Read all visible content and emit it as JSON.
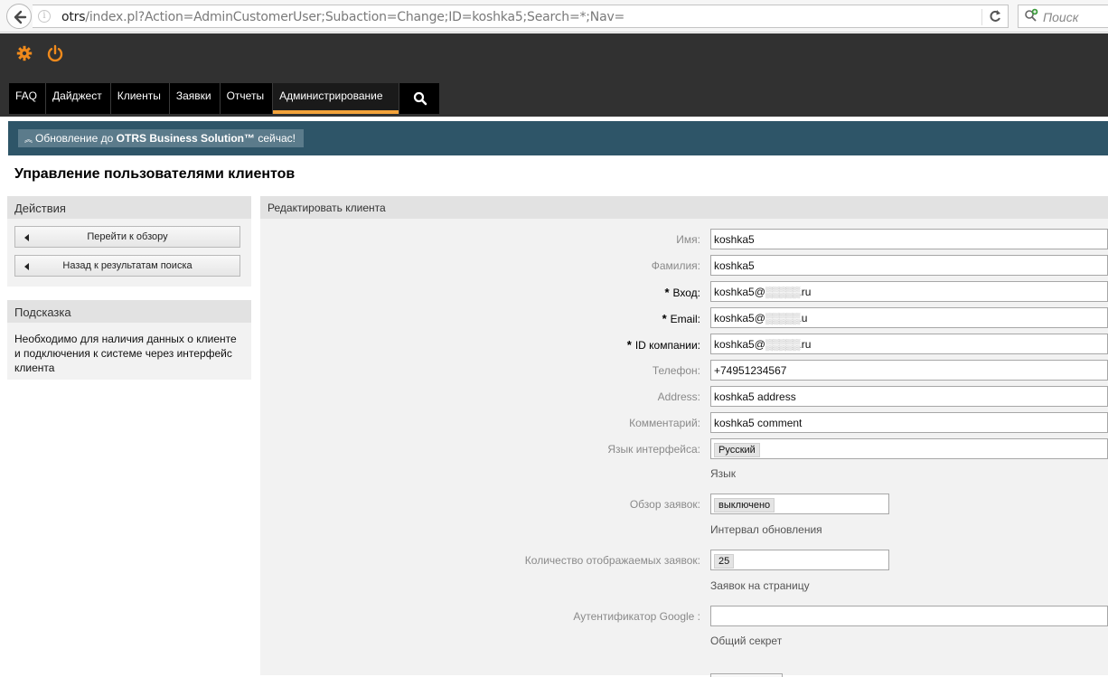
{
  "browser": {
    "url_host": "otrs",
    "url_rest": "/index.pl?Action=AdminCustomerUser;Subaction=Change;ID=koshka5;Search=*;Nav=",
    "search_placeholder": "Поиск"
  },
  "header": {
    "nav": [
      "FAQ",
      "Дайджест",
      "Клиенты",
      "Заявки",
      "Отчеты",
      "Администрирование"
    ],
    "active_nav": "Администрирование",
    "accent_color": "#f2a23a"
  },
  "upgrade": {
    "prefix": "Обновление до ",
    "product": "OTRS Business Solution™",
    "suffix": " сейчас!"
  },
  "page_title": "Управление пользователями клиентов",
  "sidebar": {
    "actions_title": "Действия",
    "go_overview": "Перейти к обзору",
    "back_to_results": "Назад к результатам поиска",
    "hint_title": "Подсказка",
    "hint_text": "Необходимо для наличия данных о клиенте и подключения к системе через интерфейс клиента"
  },
  "form": {
    "title": "Редактировать клиента",
    "fields": [
      {
        "label": "Имя:",
        "value": "koshka5",
        "required": false
      },
      {
        "label": "Фамилия:",
        "value": "koshka5",
        "required": false
      },
      {
        "label": "Вход:",
        "value": "koshka5@",
        "value_tail": "ru",
        "required": true
      },
      {
        "label": "Email:",
        "value": "koshka5@",
        "value_tail": "u",
        "required": true
      },
      {
        "label": "ID компании:",
        "value": "koshka5@",
        "value_tail": "ru",
        "required": true
      },
      {
        "label": "Телефон:",
        "value": "+74951234567",
        "required": false
      },
      {
        "label": "Address:",
        "value": "koshka5 address",
        "required": false
      },
      {
        "label": "Комментарий:",
        "value": "koshka5 comment",
        "required": false
      }
    ],
    "language": {
      "label": "Язык интерфейса:",
      "value": "Русский",
      "hint": "Язык"
    },
    "ticket_overview": {
      "label": "Обзор заявок:",
      "value": "выключено",
      "hint": "Интервал обновления"
    },
    "ticket_count": {
      "label": "Количество отображаемых заявок:",
      "value": "25",
      "hint": "Заявок на страницу"
    },
    "google_auth": {
      "label": "Аутентификатор Google :",
      "value": "",
      "hint": "Общий секрет"
    },
    "required_marker": "*"
  }
}
